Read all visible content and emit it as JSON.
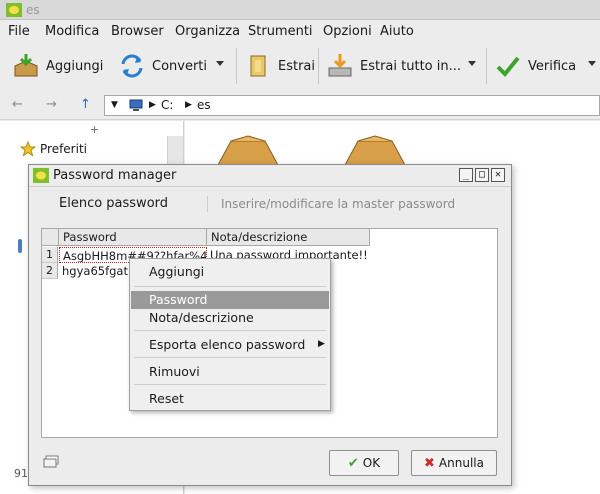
{
  "window": {
    "title": "es"
  },
  "menu": [
    "File",
    "Modifica",
    "Browser",
    "Organizza",
    "Strumenti",
    "Opzioni",
    "Aiuto"
  ],
  "toolbar": {
    "add": "Aggiungi",
    "convert": "Converti",
    "extract": "Estrai",
    "extract_all": "Estrai tutto in...",
    "verify": "Verifica"
  },
  "path": {
    "drive": "C:",
    "folder": "es"
  },
  "sidebar": {
    "favorites": "Preferiti",
    "side_number": "91"
  },
  "dialog": {
    "title": "Password manager",
    "tab_list": "Elenco password",
    "tab_master": "Inserire/modificare la master password",
    "columns": [
      "Password",
      "Nota/descrizione"
    ],
    "rows": [
      {
        "num": "1",
        "password": "AsgbHH8m##9??hfar%4",
        "note": "Una password importante!!"
      },
      {
        "num": "2",
        "password": "hgya65fgatr",
        "note": ""
      }
    ],
    "ok": "OK",
    "cancel": "Annulla"
  },
  "context_menu": {
    "items": [
      "Aggiungi",
      "Password",
      "Nota/descrizione",
      "Esporta elenco password",
      "Rimuovi",
      "Reset"
    ],
    "selected": "Password"
  },
  "colors": {
    "accent_green": "#3aa52a",
    "cancel_red": "#d02a2a",
    "selection": "#9a9a9a"
  }
}
